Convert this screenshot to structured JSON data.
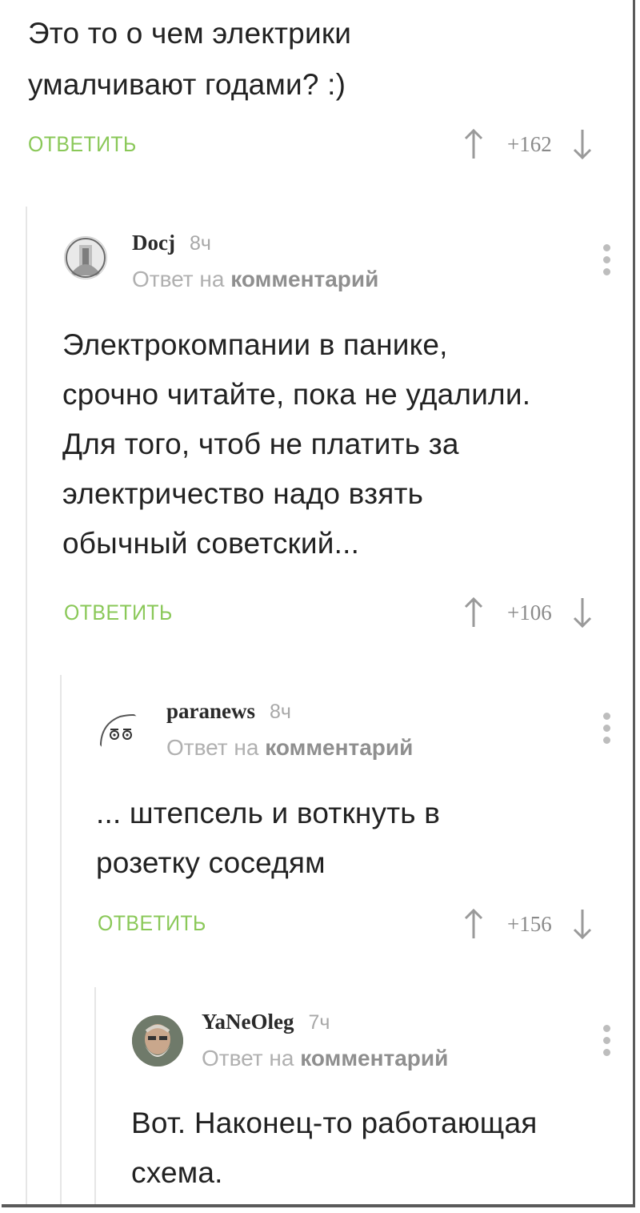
{
  "comments": [
    {
      "text": "Это то о чем электрики\nумалчивают годами? :)",
      "reply_label": "ОТВЕТИТЬ",
      "rating": "+162"
    },
    {
      "author": "Docj",
      "time": "8ч",
      "reply_to_prefix": "Ответ на",
      "reply_to_target": "комментарий",
      "text": "Электрокомпании в панике,\nсрочно читайте, пока не удалили.\nДля того, чтоб не платить за\nэлектричество надо взять\nобычный советский...",
      "reply_label": "ОТВЕТИТЬ",
      "rating": "+106"
    },
    {
      "author": "paranews",
      "time": "8ч",
      "reply_to_prefix": "Ответ на",
      "reply_to_target": "комментарий",
      "text": "... штепсель и воткнуть в\nрозетку соседям",
      "reply_label": "ОТВЕТИТЬ",
      "rating": "+156"
    },
    {
      "author": "YaNeOleg",
      "time": "7ч",
      "reply_to_prefix": "Ответ на",
      "reply_to_target": "комментарий",
      "text": "Вот. Наконец-то работающая\nсхема."
    }
  ],
  "icons": {
    "upvote": "arrow-up-icon",
    "downvote": "arrow-down-icon",
    "more": "more-vertical-icon"
  },
  "colors": {
    "reply_green": "#8ac858",
    "muted_gray": "#a8a8a8",
    "thread_line": "#e6e6e6"
  }
}
